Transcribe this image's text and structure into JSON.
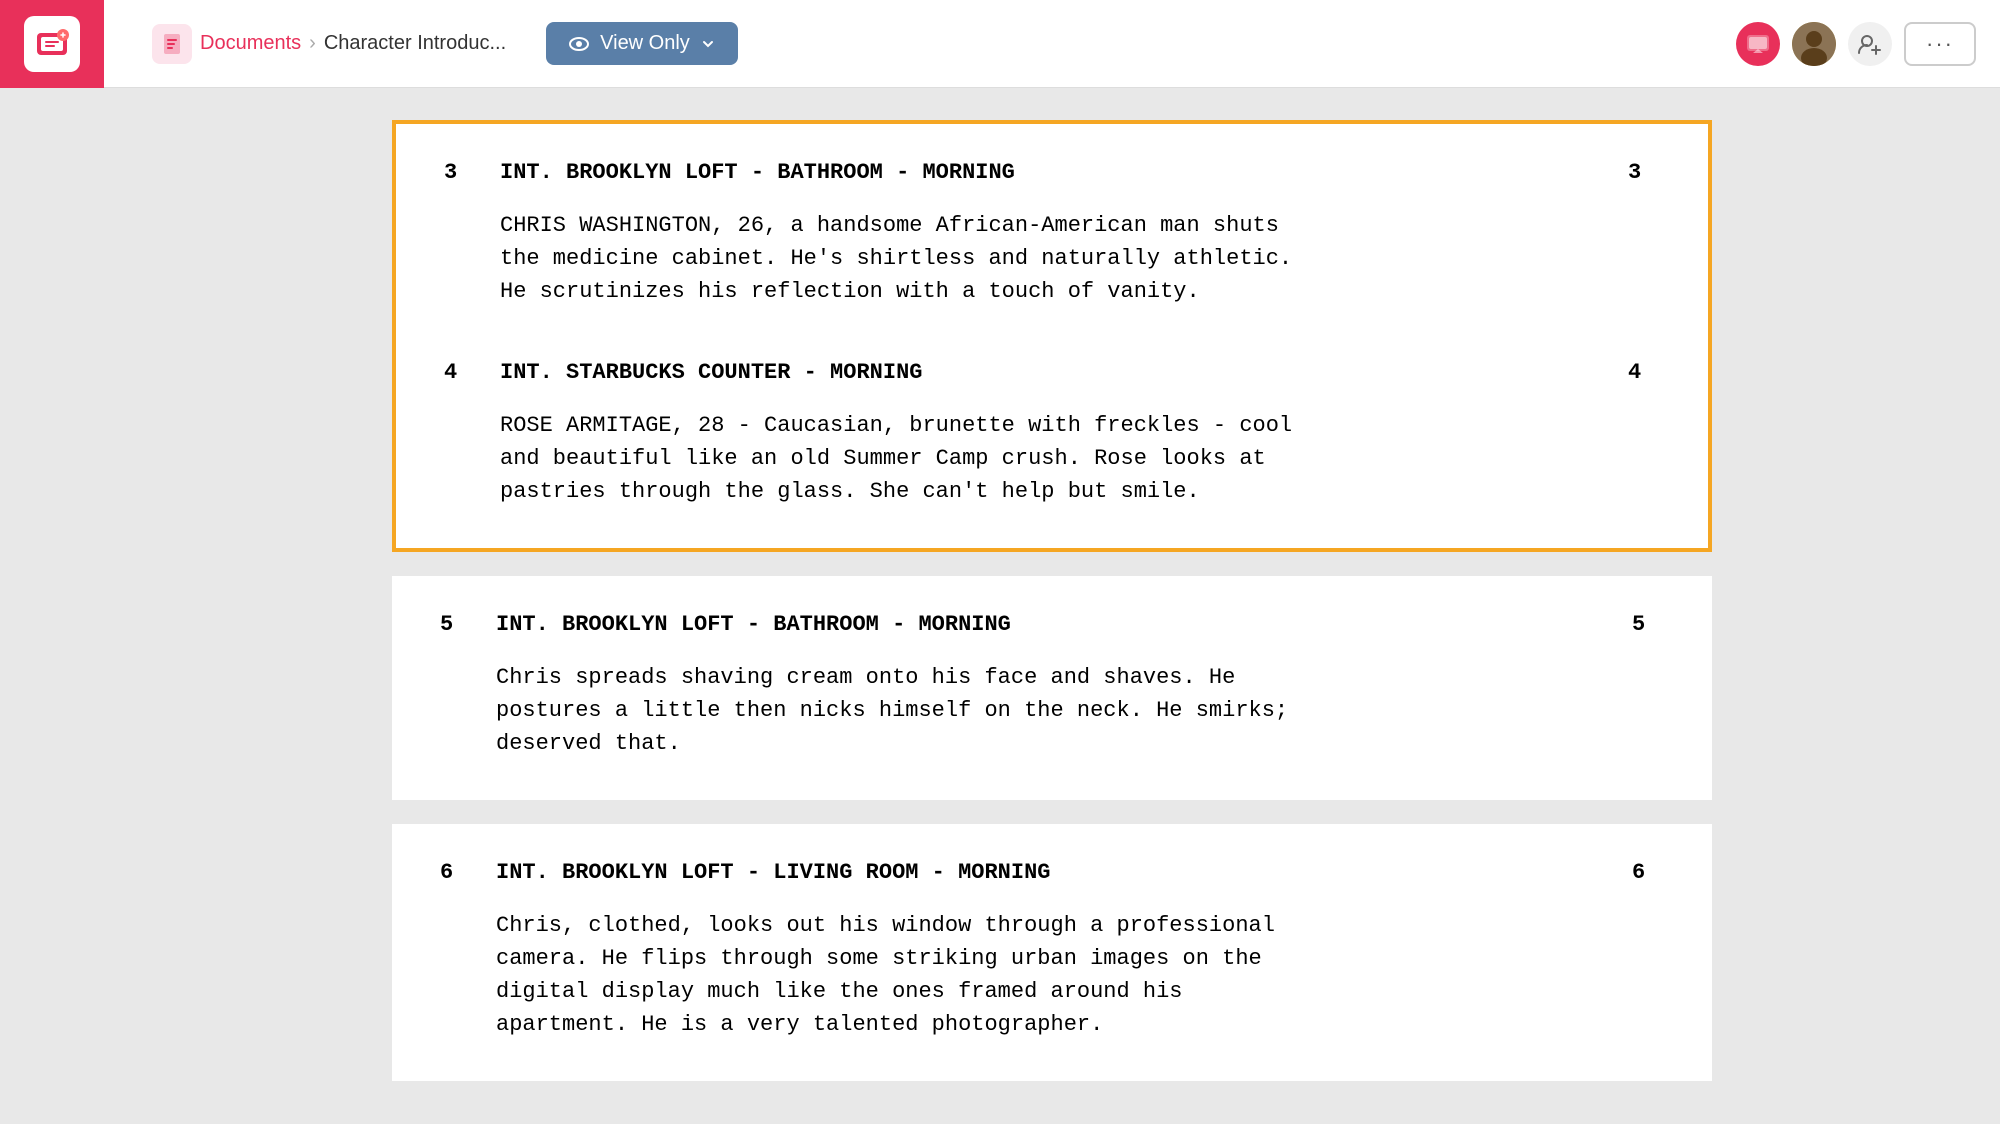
{
  "topbar": {
    "docs_label": "Documents",
    "breadcrumb_title": "Character Introduc...",
    "view_only_label": "View Only"
  },
  "scenes": [
    {
      "number": "3",
      "heading": "INT. BROOKLYN LOFT - BATHROOM - MORNING",
      "body": "CHRIS WASHINGTON, 26, a handsome African-American man shuts\nthe medicine cabinet. He's shirtless and naturally athletic.\nHe scrutinizes his reflection with a touch of vanity.",
      "highlighted": true
    },
    {
      "number": "4",
      "heading": "INT. STARBUCKS COUNTER - MORNING",
      "body": "ROSE ARMITAGE, 28 - Caucasian, brunette with freckles - cool\nand beautiful like an old Summer Camp crush. Rose looks at\npastries through the glass. She can't help but smile.",
      "highlighted": true
    },
    {
      "number": "5",
      "heading": "INT. BROOKLYN LOFT - BATHROOM - MORNING",
      "body": "Chris spreads shaving cream onto his face and shaves. He\npostures a little then nicks himself on the neck. He smirks;\ndeserved that.",
      "highlighted": false
    },
    {
      "number": "6",
      "heading": "INT. BROOKLYN LOFT - LIVING ROOM - MORNING",
      "body": "Chris, clothed, looks out his window through a professional\ncamera. He flips through some striking urban images on the\ndigital display much like the ones framed around his\napartment. He is a very talented photographer.",
      "highlighted": false
    }
  ]
}
